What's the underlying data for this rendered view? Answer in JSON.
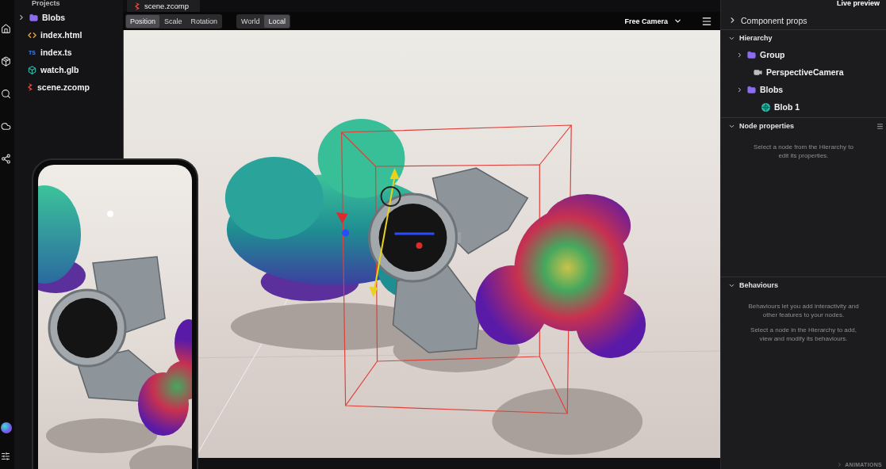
{
  "file_panel": {
    "title": "Projects",
    "items": [
      {
        "name": "Blobs",
        "kind": "folder",
        "expanded": false
      },
      {
        "name": "index.html",
        "kind": "html"
      },
      {
        "name": "index.ts",
        "kind": "ts",
        "badge": "TS"
      },
      {
        "name": "watch.glb",
        "kind": "model"
      },
      {
        "name": "scene.zcomp",
        "kind": "scene"
      }
    ]
  },
  "editor_tabs": [
    {
      "label": "scene.zcomp",
      "selected": true
    }
  ],
  "toolbar": {
    "transform_modes": [
      {
        "label": "Position",
        "selected": true
      },
      {
        "label": "Scale",
        "selected": false
      },
      {
        "label": "Rotation",
        "selected": false
      }
    ],
    "spaces": [
      {
        "label": "World",
        "selected": false
      },
      {
        "label": "Local",
        "selected": true
      }
    ],
    "camera": "Free Camera"
  },
  "right_panel": {
    "title": "Live preview",
    "component_props": {
      "label": "Component props",
      "expanded": false
    },
    "hierarchy": {
      "label": "Hierarchy",
      "expanded": true,
      "nodes": [
        {
          "name": "Group",
          "kind": "folder",
          "expanded": false
        },
        {
          "name": "PerspectiveCamera",
          "kind": "camera"
        },
        {
          "name": "Blobs",
          "kind": "folder",
          "expanded": false,
          "children": [
            {
              "name": "Blob 1",
              "kind": "mesh"
            }
          ]
        }
      ]
    },
    "node_properties": {
      "label": "Node properties",
      "expanded": true,
      "message": "Select a node from the Hierarchy to edit its properties."
    },
    "behaviours": {
      "label": "Behaviours",
      "expanded": true,
      "messages": [
        "Behaviours let you add interactivity and other features to your nodes.",
        "Select a node in the Hierarchy to add, view and modify its behaviours."
      ]
    }
  },
  "animations": {
    "label": "ANIMATIONS",
    "expanded": false
  }
}
